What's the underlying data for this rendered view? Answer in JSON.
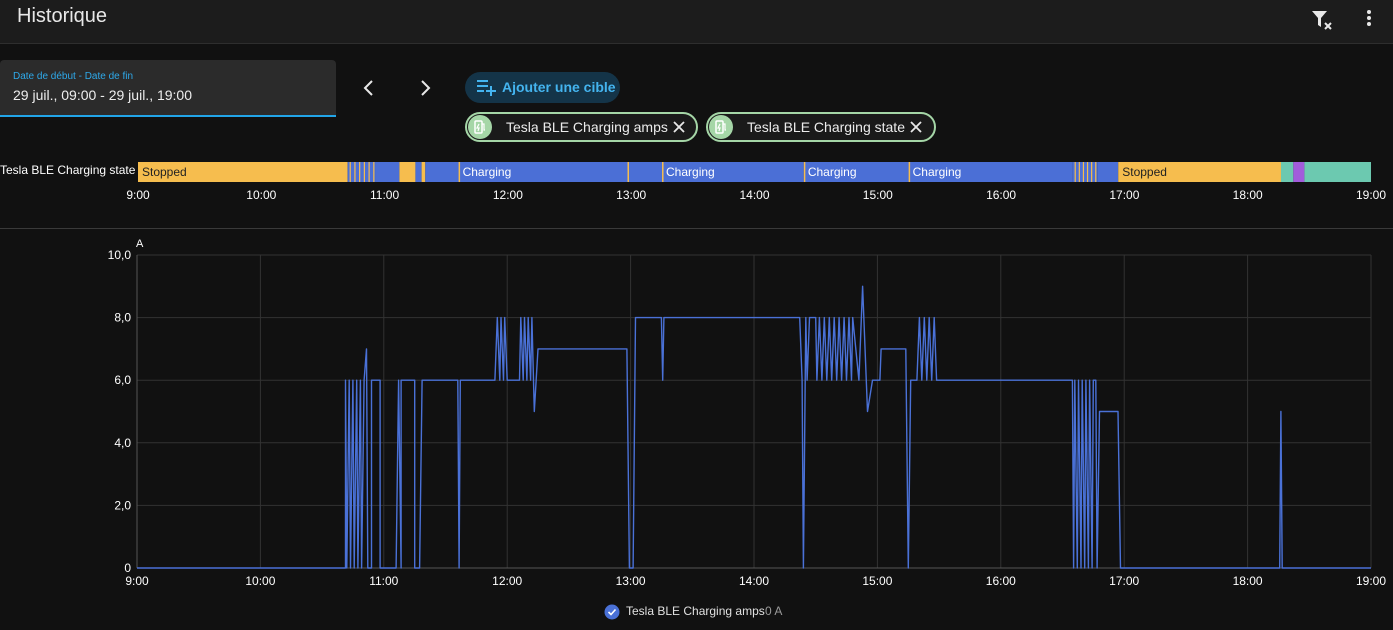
{
  "header": {
    "title": "Historique",
    "filter_icon": "filter-remove-icon",
    "menu_icon": "dots-vertical-icon"
  },
  "date_picker": {
    "label": "Date de début - Date de fin",
    "value": "29 juil., 09:00 - 29 juil., 19:00"
  },
  "nav": {
    "prev_icon": "chevron-left-icon",
    "next_icon": "chevron-right-icon"
  },
  "add_target": {
    "label": "Ajouter une cible",
    "icon": "playlist-plus-icon"
  },
  "chips": [
    {
      "label": "Tesla BLE Charging amps",
      "icon": "ev-station-icon"
    },
    {
      "label": "Tesla BLE Charging state",
      "icon": "ev-station-icon"
    }
  ],
  "colors": {
    "stopped": "#f6bd4e",
    "charging": "#4b6fd6",
    "teal": "#6cc9b0",
    "purple": "#a25cdb",
    "line": "#4a71d7",
    "chip_border": "#a5d6a7",
    "accent": "#2ea9ea"
  },
  "timeline": {
    "entity_label": "Tesla BLE Charging state",
    "x_ticks": [
      "9:00",
      "10:00",
      "11:00",
      "12:00",
      "13:00",
      "14:00",
      "15:00",
      "16:00",
      "17:00",
      "18:00",
      "19:00"
    ],
    "segments": [
      {
        "start": 9.0,
        "end": 10.7,
        "state": "stopped",
        "label": "Stopped"
      },
      {
        "start": 10.7,
        "end": 10.93,
        "state": "mixed",
        "label": ""
      },
      {
        "start": 10.93,
        "end": 11.12,
        "state": "charging",
        "label": ""
      },
      {
        "start": 11.12,
        "end": 11.25,
        "state": "stopped",
        "label": ""
      },
      {
        "start": 11.25,
        "end": 11.3,
        "state": "charging",
        "label": ""
      },
      {
        "start": 11.3,
        "end": 11.33,
        "state": "stopped",
        "label": ""
      },
      {
        "start": 11.33,
        "end": 11.6,
        "state": "charging",
        "label": ""
      },
      {
        "start": 11.6,
        "end": 12.97,
        "state": "charging",
        "label": "Charging"
      },
      {
        "start": 12.97,
        "end": 13.25,
        "state": "charging",
        "label": ""
      },
      {
        "start": 13.25,
        "end": 14.4,
        "state": "charging",
        "label": "Charging"
      },
      {
        "start": 14.4,
        "end": 15.25,
        "state": "charging",
        "label": "Charging"
      },
      {
        "start": 15.25,
        "end": 16.58,
        "state": "charging",
        "label": "Charging"
      },
      {
        "start": 16.58,
        "end": 16.78,
        "state": "mixed",
        "label": ""
      },
      {
        "start": 16.78,
        "end": 16.95,
        "state": "charging",
        "label": ""
      },
      {
        "start": 16.95,
        "end": 18.27,
        "state": "stopped",
        "label": "Stopped"
      },
      {
        "start": 18.27,
        "end": 18.37,
        "state": "teal",
        "label": ""
      },
      {
        "start": 18.37,
        "end": 18.46,
        "state": "purple",
        "label": ""
      },
      {
        "start": 18.46,
        "end": 19.0,
        "state": "teal",
        "label": ""
      }
    ]
  },
  "chart_data": {
    "type": "line",
    "ylabel": "A",
    "xlim": [
      9,
      19
    ],
    "ylim": [
      0,
      10
    ],
    "y_ticks": [
      "0",
      "2,0",
      "4,0",
      "6,0",
      "8,0",
      "10,0"
    ],
    "x_ticks": [
      "9:00",
      "10:00",
      "11:00",
      "12:00",
      "13:00",
      "14:00",
      "15:00",
      "16:00",
      "17:00",
      "18:00",
      "19:00"
    ],
    "grid": true,
    "legend_position": "bottom",
    "series": [
      {
        "name": "Tesla BLE Charging amps",
        "current_value": "0 A",
        "points": [
          [
            9.0,
            0
          ],
          [
            10.69,
            0
          ],
          [
            10.69,
            6
          ],
          [
            10.7,
            0
          ],
          [
            10.72,
            6
          ],
          [
            10.73,
            0
          ],
          [
            10.75,
            6
          ],
          [
            10.76,
            0
          ],
          [
            10.78,
            6
          ],
          [
            10.79,
            0
          ],
          [
            10.81,
            6
          ],
          [
            10.82,
            0
          ],
          [
            10.84,
            6
          ],
          [
            10.86,
            7
          ],
          [
            10.87,
            0
          ],
          [
            10.9,
            0
          ],
          [
            10.9,
            6
          ],
          [
            10.97,
            6
          ],
          [
            10.97,
            0
          ],
          [
            11.1,
            0
          ],
          [
            11.12,
            6
          ],
          [
            11.14,
            0
          ],
          [
            11.14,
            6
          ],
          [
            11.25,
            6
          ],
          [
            11.25,
            0
          ],
          [
            11.29,
            0
          ],
          [
            11.31,
            6
          ],
          [
            11.6,
            6
          ],
          [
            11.61,
            0
          ],
          [
            11.62,
            6
          ],
          [
            11.9,
            6
          ],
          [
            11.92,
            8
          ],
          [
            11.94,
            6
          ],
          [
            11.95,
            8
          ],
          [
            11.97,
            6
          ],
          [
            11.98,
            8
          ],
          [
            12.0,
            6
          ],
          [
            12.1,
            6
          ],
          [
            12.11,
            8
          ],
          [
            12.13,
            6
          ],
          [
            12.14,
            8
          ],
          [
            12.16,
            6
          ],
          [
            12.17,
            8
          ],
          [
            12.19,
            6
          ],
          [
            12.2,
            8
          ],
          [
            12.22,
            5
          ],
          [
            12.25,
            7
          ],
          [
            12.97,
            7
          ],
          [
            12.99,
            0
          ],
          [
            13.02,
            0
          ],
          [
            13.04,
            8
          ],
          [
            13.25,
            8
          ],
          [
            13.26,
            6
          ],
          [
            13.27,
            8
          ],
          [
            14.37,
            8
          ],
          [
            14.39,
            6
          ],
          [
            14.4,
            0
          ],
          [
            14.42,
            8
          ],
          [
            14.43,
            6
          ],
          [
            14.45,
            8
          ],
          [
            14.5,
            8
          ],
          [
            14.51,
            6
          ],
          [
            14.53,
            8
          ],
          [
            14.55,
            6
          ],
          [
            14.57,
            8
          ],
          [
            14.59,
            6
          ],
          [
            14.61,
            8
          ],
          [
            14.63,
            6
          ],
          [
            14.65,
            8
          ],
          [
            14.67,
            6
          ],
          [
            14.69,
            8
          ],
          [
            14.71,
            6
          ],
          [
            14.73,
            8
          ],
          [
            14.75,
            6
          ],
          [
            14.77,
            8
          ],
          [
            14.79,
            6
          ],
          [
            14.8,
            8
          ],
          [
            14.85,
            6
          ],
          [
            14.88,
            9
          ],
          [
            14.92,
            5
          ],
          [
            14.96,
            6
          ],
          [
            15.02,
            6
          ],
          [
            15.03,
            7
          ],
          [
            15.23,
            7
          ],
          [
            15.25,
            0
          ],
          [
            15.27,
            6
          ],
          [
            15.32,
            6
          ],
          [
            15.34,
            8
          ],
          [
            15.36,
            6
          ],
          [
            15.38,
            8
          ],
          [
            15.4,
            6
          ],
          [
            15.42,
            8
          ],
          [
            15.44,
            6
          ],
          [
            15.46,
            8
          ],
          [
            15.48,
            6
          ],
          [
            15.5,
            6
          ],
          [
            16.58,
            6
          ],
          [
            16.59,
            0
          ],
          [
            16.6,
            6
          ],
          [
            16.62,
            0
          ],
          [
            16.63,
            6
          ],
          [
            16.65,
            0
          ],
          [
            16.66,
            6
          ],
          [
            16.68,
            0
          ],
          [
            16.69,
            6
          ],
          [
            16.71,
            0
          ],
          [
            16.72,
            6
          ],
          [
            16.74,
            0
          ],
          [
            16.75,
            6
          ],
          [
            16.77,
            6
          ],
          [
            16.78,
            0
          ],
          [
            16.8,
            5
          ],
          [
            16.95,
            5
          ],
          [
            16.97,
            0
          ],
          [
            18.26,
            0
          ],
          [
            18.27,
            5
          ],
          [
            18.28,
            0
          ],
          [
            18.37,
            0
          ],
          [
            18.46,
            0
          ],
          [
            19.0,
            0
          ]
        ]
      }
    ]
  }
}
